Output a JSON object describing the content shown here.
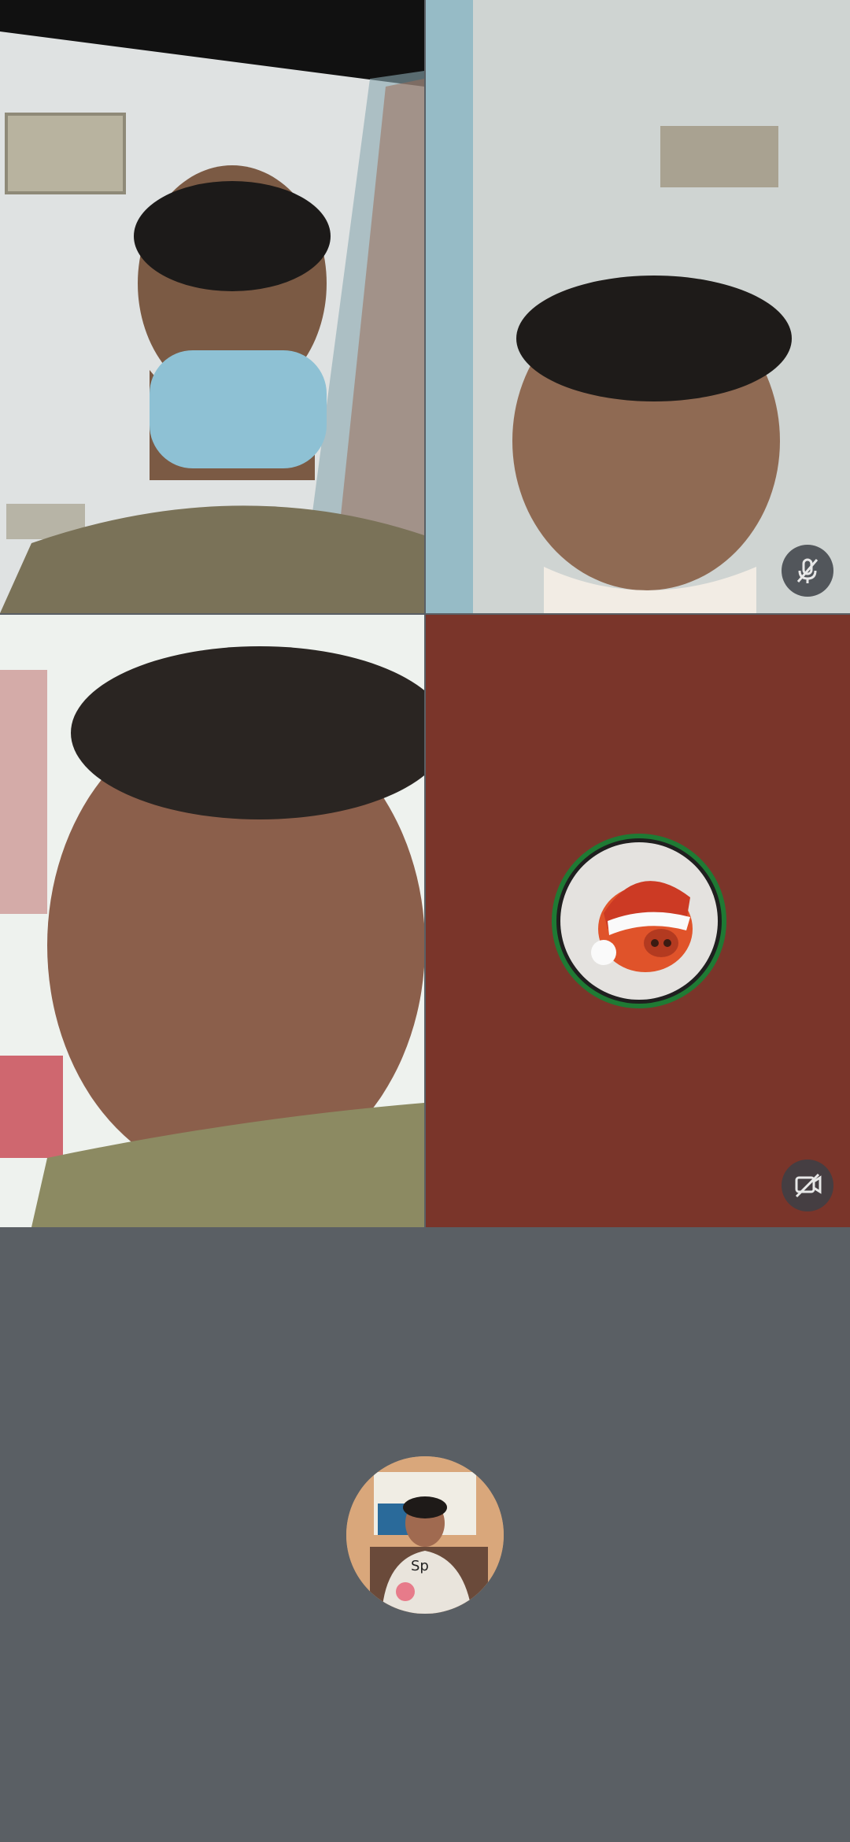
{
  "participants": [
    {
      "id": "p1",
      "type": "video",
      "muted": false,
      "camera_off": false,
      "icon": "person-video"
    },
    {
      "id": "p2",
      "type": "video",
      "muted": true,
      "camera_off": false,
      "icon": "mic-off-icon"
    },
    {
      "id": "p3",
      "type": "video",
      "muted": false,
      "camera_off": false,
      "icon": "person-video"
    },
    {
      "id": "p4",
      "type": "avatar",
      "muted": false,
      "camera_off": true,
      "icon": "camera-off-icon",
      "tile_color": "#7a352a",
      "ring_color": "#1f7a34",
      "avatar": "santa-hat-mascot-avatar"
    }
  ],
  "self": {
    "type": "avatar",
    "avatar": "self-profile-photo",
    "background": "#5a5f64"
  },
  "colors": {
    "grid_gap": "#5a5f64",
    "badge_bg": "#3c4046"
  }
}
